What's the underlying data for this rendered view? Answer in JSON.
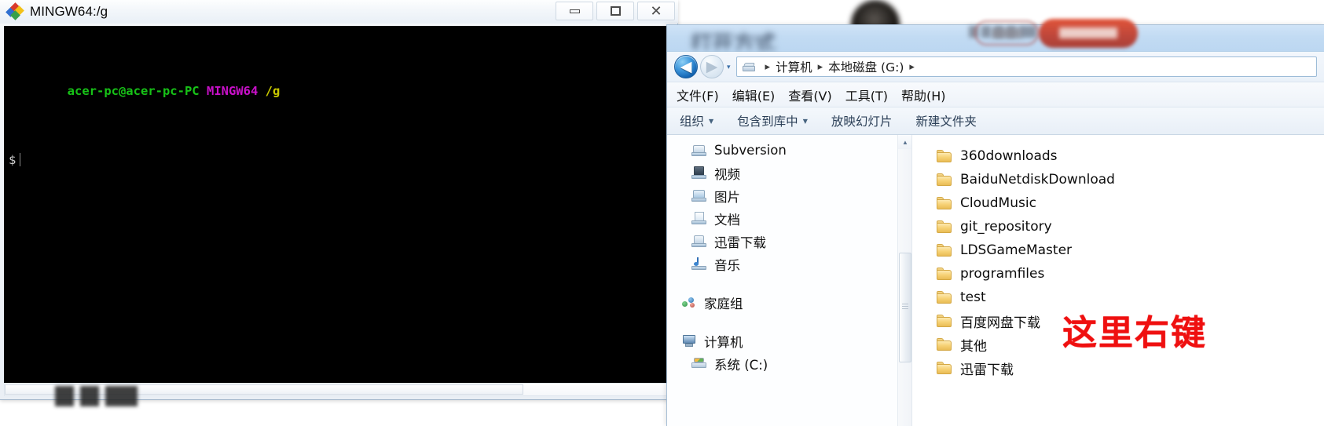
{
  "terminal": {
    "title": "MINGW64:/g",
    "app_icon": "git-bash-icon",
    "window_controls": [
      {
        "name": "minimize",
        "glyph": "minimize-icon"
      },
      {
        "name": "maximize",
        "glyph": "maximize-icon"
      },
      {
        "name": "close",
        "glyph": "close-icon",
        "label": "✕"
      }
    ],
    "console": {
      "prompt_user_host": "acer-pc@acer-pc-PC",
      "shell_env": "MINGW64",
      "path": "/g",
      "prompt_symbol": "$",
      "colors": {
        "background": "#000000",
        "user_host": "#17c217",
        "shell_env": "#c810c8",
        "path": "#c8c800",
        "prompt": "#cccccc"
      }
    }
  },
  "explorer": {
    "title_blurred": "打开方式",
    "nav": {
      "back_label": "◀",
      "forward_label": "▶",
      "history_label": "▾",
      "address_icon": "drive-icon",
      "breadcrumbs": [
        "计算机",
        "本地磁盘 (G:)"
      ],
      "separator": "▸"
    },
    "menubar": [
      "文件(F)",
      "编辑(E)",
      "查看(V)",
      "工具(T)",
      "帮助(H)"
    ],
    "toolbar": [
      {
        "label": "组织",
        "has_caret": true
      },
      {
        "label": "包含到库中",
        "has_caret": true
      },
      {
        "label": "放映幻灯片",
        "has_caret": false
      },
      {
        "label": "新建文件夹",
        "has_caret": false
      }
    ],
    "nav_pane": [
      {
        "label": "Subversion",
        "icon": "subversion-folder-icon",
        "group": false
      },
      {
        "label": "视频",
        "icon": "video-library-icon",
        "group": false
      },
      {
        "label": "图片",
        "icon": "pictures-library-icon",
        "group": false
      },
      {
        "label": "文档",
        "icon": "documents-library-icon",
        "group": false
      },
      {
        "label": "迅雷下载",
        "icon": "thunder-download-library-icon",
        "group": false
      },
      {
        "label": "音乐",
        "icon": "music-library-icon",
        "group": false
      },
      {
        "label": "家庭组",
        "icon": "homegroup-icon",
        "group": true
      },
      {
        "label": "计算机",
        "icon": "computer-icon",
        "group": true
      },
      {
        "label": "系统 (C:)",
        "icon": "system-drive-icon",
        "group": false
      }
    ],
    "files": [
      {
        "name": "360downloads",
        "icon": "folder-icon"
      },
      {
        "name": "BaiduNetdiskDownload",
        "icon": "folder-icon"
      },
      {
        "name": "CloudMusic",
        "icon": "folder-icon"
      },
      {
        "name": "git_repository",
        "icon": "folder-icon"
      },
      {
        "name": "LDSGameMaster",
        "icon": "folder-icon"
      },
      {
        "name": "programfiles",
        "icon": "folder-icon"
      },
      {
        "name": "test",
        "icon": "folder-icon"
      },
      {
        "name": "百度网盘下载",
        "icon": "folder-icon"
      },
      {
        "name": "其他",
        "icon": "folder-icon"
      },
      {
        "name": "迅雷下载",
        "icon": "folder-icon"
      }
    ],
    "scrollbar": {
      "up_arrow": "▲",
      "down_arrow": "▼"
    }
  },
  "annotation": {
    "text": "这里右键",
    "color": "#ef1010"
  }
}
